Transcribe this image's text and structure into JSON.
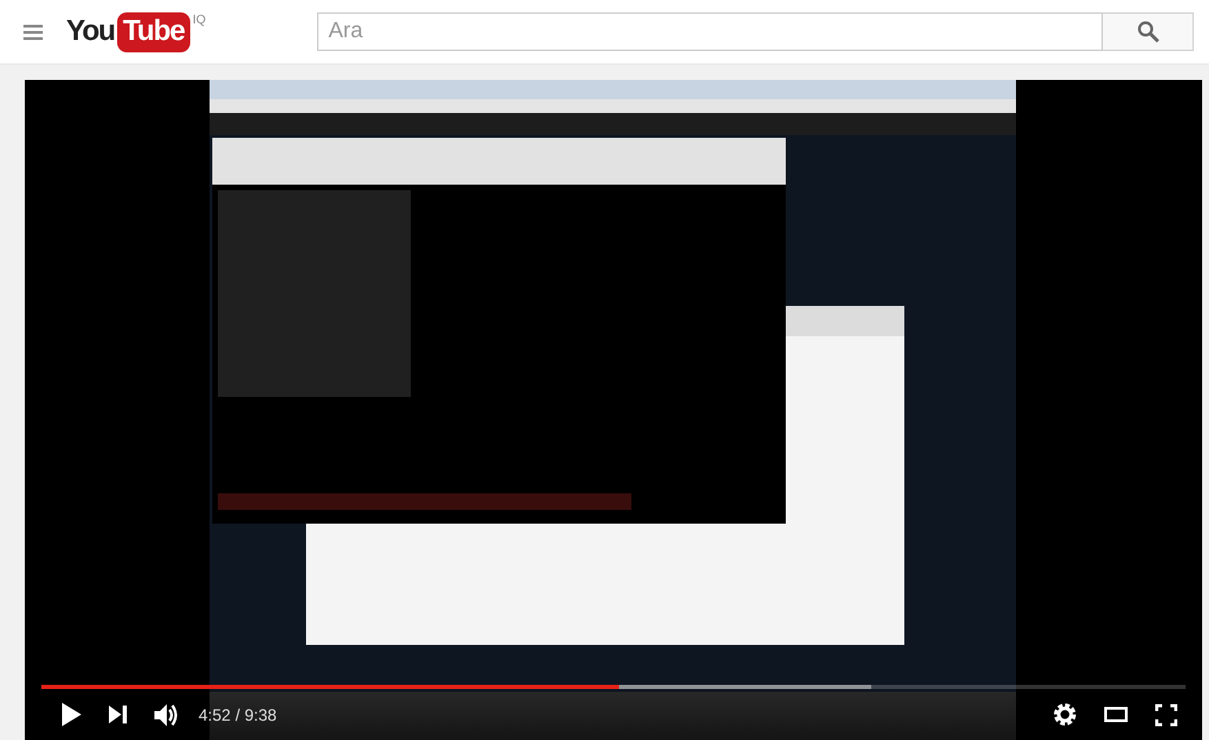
{
  "header": {
    "logo": {
      "you": "You",
      "tube": "Tube",
      "region": "IQ"
    },
    "search": {
      "placeholder": "Ara"
    }
  },
  "player": {
    "progress": {
      "level": 0.505
    },
    "buffer": {
      "level": 0.725
    },
    "time": "4:52 / 9:38"
  }
}
